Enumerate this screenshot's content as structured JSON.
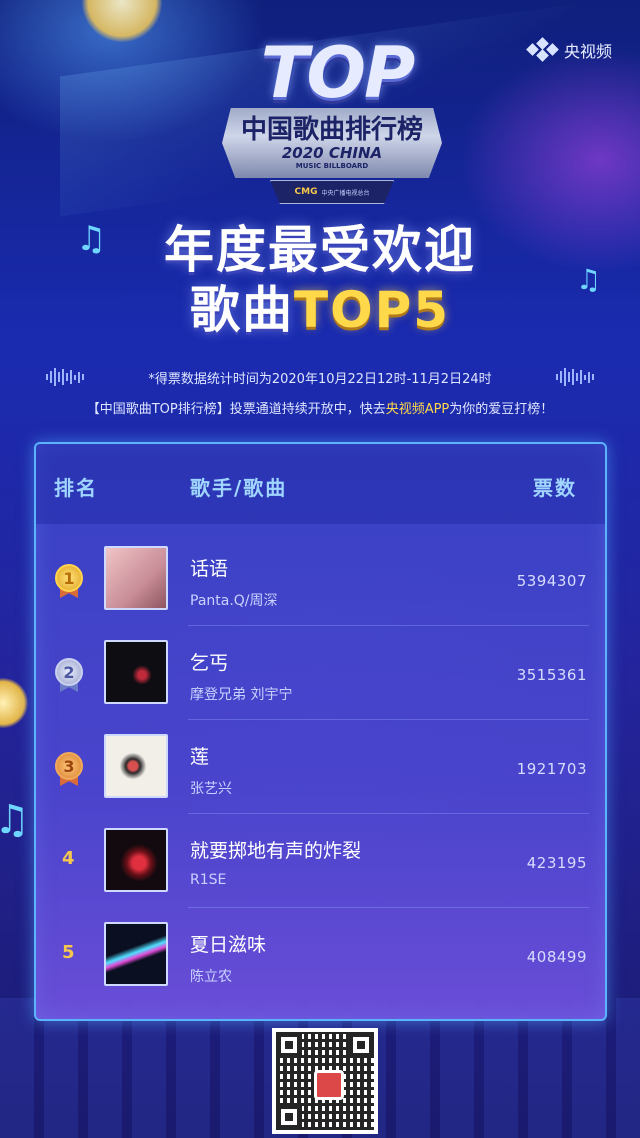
{
  "brand": {
    "label": "央视频",
    "icon": "cctv-video-logo-icon"
  },
  "logo": {
    "top": "TOP",
    "title": "中国歌曲排行榜",
    "year_line": "2020 CHINA",
    "sub": "MUSIC BILLBOARD",
    "cmg": "CMG",
    "cmg_sub": "中央广播电视总台"
  },
  "headline": {
    "line1": "年度最受欢迎",
    "line2_prefix": "歌曲",
    "line2_accent": "TOP5"
  },
  "info": {
    "line1": "*得票数据统计时间为2020年10月22日12时-11月2日24时",
    "line2_prefix": "【中国歌曲TOP排行榜】投票通道持续开放中，快去",
    "line2_highlight": "央视频APP",
    "line2_suffix": "为你的爱豆打榜！"
  },
  "table": {
    "headers": {
      "rank": "排名",
      "artist_song": "歌手/歌曲",
      "votes": "票数"
    },
    "rows": [
      {
        "rank": "1",
        "medal": "gold",
        "title": "话语",
        "artist": "Panta.Q/周深",
        "votes": "5394307",
        "cover_colors": [
          "#e6b5b8",
          "#b27c86"
        ]
      },
      {
        "rank": "2",
        "medal": "silver",
        "title": "乞丐",
        "artist": "摩登兄弟 刘宇宁",
        "votes": "3515361",
        "cover_colors": [
          "#0d0d10",
          "#d43a3a"
        ]
      },
      {
        "rank": "3",
        "medal": "bronze",
        "title": "莲",
        "artist": "张艺兴",
        "votes": "1921703",
        "cover_colors": [
          "#f1eee8",
          "#c24848"
        ]
      },
      {
        "rank": "4",
        "medal": "none",
        "title": "就要掷地有声的炸裂",
        "artist": "R1SE",
        "votes": "423195",
        "cover_colors": [
          "#140c10",
          "#b8262f"
        ]
      },
      {
        "rank": "5",
        "medal": "none",
        "title": "夏日滋味",
        "artist": "陈立农",
        "votes": "408499",
        "cover_colors": [
          "#0a1020",
          "#44d7ff"
        ]
      }
    ]
  },
  "qr": {
    "icon": "qr-code-icon"
  },
  "colors": {
    "accent_yellow": "#ffd94a",
    "panel_border": "#5cb3ff",
    "header_text": "#9fd5ff"
  }
}
